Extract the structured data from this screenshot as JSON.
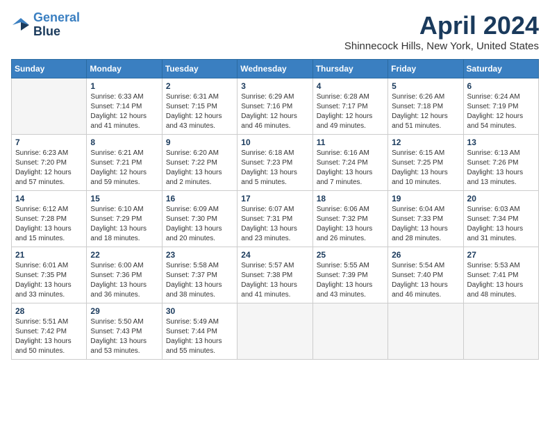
{
  "header": {
    "logo_line1": "General",
    "logo_line2": "Blue",
    "month": "April 2024",
    "location": "Shinnecock Hills, New York, United States"
  },
  "days_of_week": [
    "Sunday",
    "Monday",
    "Tuesday",
    "Wednesday",
    "Thursday",
    "Friday",
    "Saturday"
  ],
  "weeks": [
    [
      {
        "day": "",
        "info": ""
      },
      {
        "day": "1",
        "info": "Sunrise: 6:33 AM\nSunset: 7:14 PM\nDaylight: 12 hours\nand 41 minutes."
      },
      {
        "day": "2",
        "info": "Sunrise: 6:31 AM\nSunset: 7:15 PM\nDaylight: 12 hours\nand 43 minutes."
      },
      {
        "day": "3",
        "info": "Sunrise: 6:29 AM\nSunset: 7:16 PM\nDaylight: 12 hours\nand 46 minutes."
      },
      {
        "day": "4",
        "info": "Sunrise: 6:28 AM\nSunset: 7:17 PM\nDaylight: 12 hours\nand 49 minutes."
      },
      {
        "day": "5",
        "info": "Sunrise: 6:26 AM\nSunset: 7:18 PM\nDaylight: 12 hours\nand 51 minutes."
      },
      {
        "day": "6",
        "info": "Sunrise: 6:24 AM\nSunset: 7:19 PM\nDaylight: 12 hours\nand 54 minutes."
      }
    ],
    [
      {
        "day": "7",
        "info": "Sunrise: 6:23 AM\nSunset: 7:20 PM\nDaylight: 12 hours\nand 57 minutes."
      },
      {
        "day": "8",
        "info": "Sunrise: 6:21 AM\nSunset: 7:21 PM\nDaylight: 12 hours\nand 59 minutes."
      },
      {
        "day": "9",
        "info": "Sunrise: 6:20 AM\nSunset: 7:22 PM\nDaylight: 13 hours\nand 2 minutes."
      },
      {
        "day": "10",
        "info": "Sunrise: 6:18 AM\nSunset: 7:23 PM\nDaylight: 13 hours\nand 5 minutes."
      },
      {
        "day": "11",
        "info": "Sunrise: 6:16 AM\nSunset: 7:24 PM\nDaylight: 13 hours\nand 7 minutes."
      },
      {
        "day": "12",
        "info": "Sunrise: 6:15 AM\nSunset: 7:25 PM\nDaylight: 13 hours\nand 10 minutes."
      },
      {
        "day": "13",
        "info": "Sunrise: 6:13 AM\nSunset: 7:26 PM\nDaylight: 13 hours\nand 13 minutes."
      }
    ],
    [
      {
        "day": "14",
        "info": "Sunrise: 6:12 AM\nSunset: 7:28 PM\nDaylight: 13 hours\nand 15 minutes."
      },
      {
        "day": "15",
        "info": "Sunrise: 6:10 AM\nSunset: 7:29 PM\nDaylight: 13 hours\nand 18 minutes."
      },
      {
        "day": "16",
        "info": "Sunrise: 6:09 AM\nSunset: 7:30 PM\nDaylight: 13 hours\nand 20 minutes."
      },
      {
        "day": "17",
        "info": "Sunrise: 6:07 AM\nSunset: 7:31 PM\nDaylight: 13 hours\nand 23 minutes."
      },
      {
        "day": "18",
        "info": "Sunrise: 6:06 AM\nSunset: 7:32 PM\nDaylight: 13 hours\nand 26 minutes."
      },
      {
        "day": "19",
        "info": "Sunrise: 6:04 AM\nSunset: 7:33 PM\nDaylight: 13 hours\nand 28 minutes."
      },
      {
        "day": "20",
        "info": "Sunrise: 6:03 AM\nSunset: 7:34 PM\nDaylight: 13 hours\nand 31 minutes."
      }
    ],
    [
      {
        "day": "21",
        "info": "Sunrise: 6:01 AM\nSunset: 7:35 PM\nDaylight: 13 hours\nand 33 minutes."
      },
      {
        "day": "22",
        "info": "Sunrise: 6:00 AM\nSunset: 7:36 PM\nDaylight: 13 hours\nand 36 minutes."
      },
      {
        "day": "23",
        "info": "Sunrise: 5:58 AM\nSunset: 7:37 PM\nDaylight: 13 hours\nand 38 minutes."
      },
      {
        "day": "24",
        "info": "Sunrise: 5:57 AM\nSunset: 7:38 PM\nDaylight: 13 hours\nand 41 minutes."
      },
      {
        "day": "25",
        "info": "Sunrise: 5:55 AM\nSunset: 7:39 PM\nDaylight: 13 hours\nand 43 minutes."
      },
      {
        "day": "26",
        "info": "Sunrise: 5:54 AM\nSunset: 7:40 PM\nDaylight: 13 hours\nand 46 minutes."
      },
      {
        "day": "27",
        "info": "Sunrise: 5:53 AM\nSunset: 7:41 PM\nDaylight: 13 hours\nand 48 minutes."
      }
    ],
    [
      {
        "day": "28",
        "info": "Sunrise: 5:51 AM\nSunset: 7:42 PM\nDaylight: 13 hours\nand 50 minutes."
      },
      {
        "day": "29",
        "info": "Sunrise: 5:50 AM\nSunset: 7:43 PM\nDaylight: 13 hours\nand 53 minutes."
      },
      {
        "day": "30",
        "info": "Sunrise: 5:49 AM\nSunset: 7:44 PM\nDaylight: 13 hours\nand 55 minutes."
      },
      {
        "day": "",
        "info": ""
      },
      {
        "day": "",
        "info": ""
      },
      {
        "day": "",
        "info": ""
      },
      {
        "day": "",
        "info": ""
      }
    ]
  ]
}
